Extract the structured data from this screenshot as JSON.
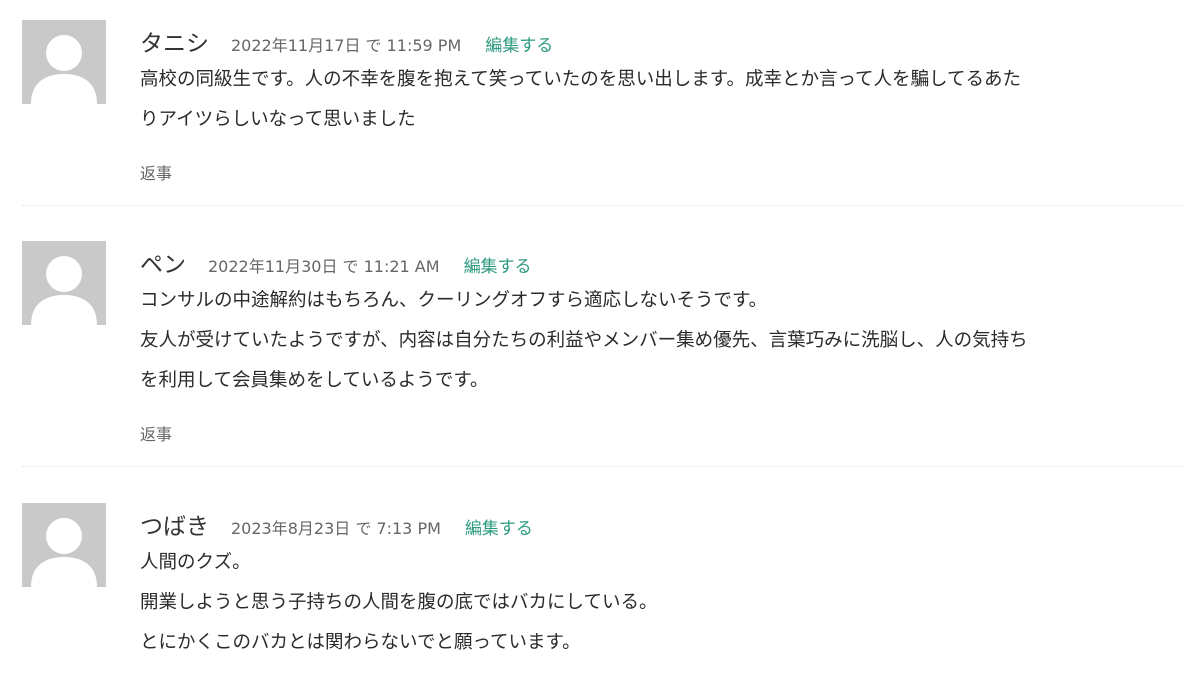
{
  "comments": [
    {
      "author": "タニシ",
      "date": "2022年11月17日 で 11:59 PM",
      "edit_label": "編集する",
      "paragraphs": [
        "高校の同級生です。人の不幸を腹を抱えて笑っていたのを思い出します。成幸とか言って人を騙してるあた",
        "りアイツらしいなって思いました"
      ],
      "reply_label": "返事"
    },
    {
      "author": "ペン",
      "date": "2022年11月30日 で 11:21 AM",
      "edit_label": "編集する",
      "paragraphs": [
        "コンサルの中途解約はもちろん、クーリングオフすら適応しないそうです。",
        "友人が受けていたようですが、内容は自分たちの利益やメンバー集め優先、言葉巧みに洗脳し、人の気持ち",
        "を利用して会員集めをしているようです。"
      ],
      "reply_label": "返事"
    },
    {
      "author": "つばき",
      "date": "2023年8月23日 で 7:13 PM",
      "edit_label": "編集する",
      "paragraphs": [
        "人間のクズ。",
        "開業しようと思う子持ちの人間を腹の底ではバカにしている。",
        "とにかくこのバカとは関わらないでと願っています。"
      ]
    }
  ],
  "colors": {
    "link": "#2e9a80",
    "avatar_bg": "#c9c9c9",
    "avatar_fg": "#ffffff",
    "meta_text": "#666666",
    "body_text": "#2b2b2b"
  },
  "icons": {
    "avatar": "default-user-silhouette-icon"
  }
}
